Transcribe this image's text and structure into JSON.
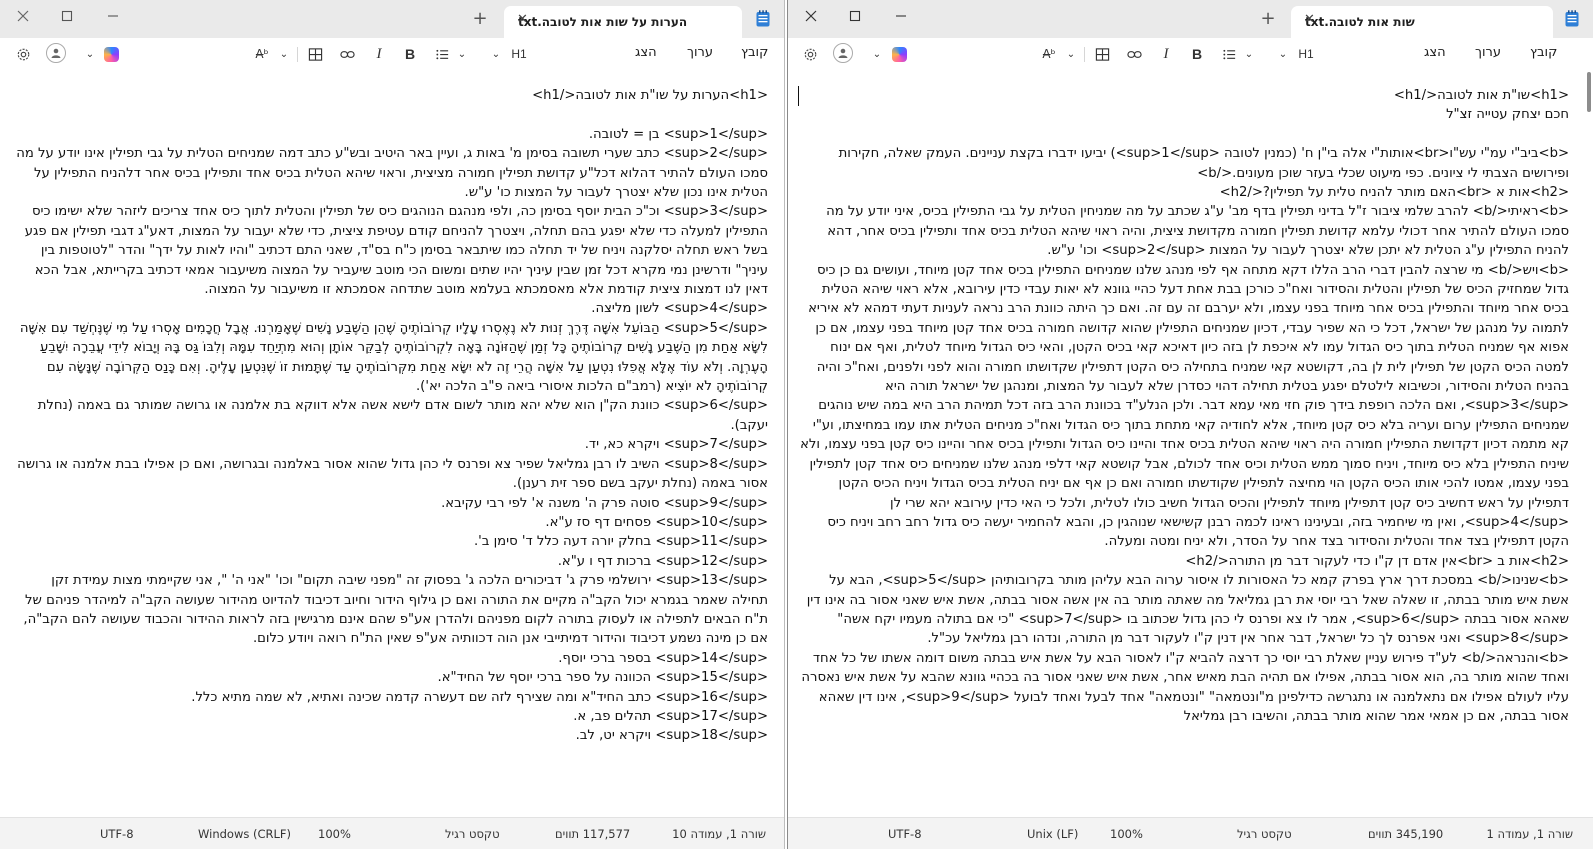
{
  "left": {
    "tab_title": "הערות על שות אות לטובה.txt",
    "menus": [
      "קובץ",
      "ערוך",
      "הצג"
    ],
    "heading_tool": "H1",
    "content": [
      "<h1>הערות על שו\"ת אות לטובה</h1>",
      "",
      "<sup>1</sup> בן = לטובה.",
      "<sup>2</sup> כתב שערי תשובה בסימן מ' באות ג, ועיין באר היטיב ובש\"ע כתב דמה שמניחים הטלית על גבי תפילין אינו יודע על מה סמכו העולם להתיר דהלוא דכל\"ע קדושת תפילין חמורה מציצית, וראוי שיהא הטלית בכיס אחד ותפילין בכיס אחר דלהניח התפילין על הטלית אינו נכון שלא יצטרך לעבור על המצות כו' ע\"ש.",
      "<sup>3</sup> וכ\"כ הבית יוסף בסימן כה, ולפי מנהגם הנוהגים כיס של תפילין והטלית לתוך כיס אחד צריכים ליזהר שלא ישימו כיס התפילין למעלה כדי שלא יפגע בהם תחלה, ויצטרך להניחם קודם עטיפת ציצית, כדי שלא יעבור על המצות, דאע\"ג דגבי תפילין אם פגע בשל ראש תחלה יסלקנה ויניח של יד תחלה כמו שיתבאר בסימן כ\"ח בס\"ד, שאני התם דכתיב \"והיו לאות על ידך\" והדר \"לטוטפות בין עיניך\" ודרשינן נמי מקרא דכל זמן שבין עיניך יהיו שתים ומשום הכי מוטב שיעביר על המצוה משיעבור אמאי דכתיב בקרייתא, אבל הכא דאין לנו דמצות ציצית קודמת אלא מאסמכתא בעלמא מוטב שתדחה אסמכתא זו משיעבור על המצוה.",
      "<sup>4</sup> לשון מליצה.",
      "<sup>5</sup> הַבּוֹעֵל אִשָּׁה דֶּרֶךְ זְנוּת לֹא נֶאֶסְרוּ עָלָיו קְרוֹבוֹתֶיהָ שֶׁהֵן הַשֶּׁבַע נָשִׁים שֶׁאָמַרְנוּ. אֲבָל חֲכָמִים אָסְרוּ עַל מִי שֶׁנֶּחְשַׁד עִם אִשָּׁה לִשָּׂא אַחַת מִן הַשֶּׁבַע נָשִׁים קְרוֹבוֹתֶיהָ כָּל זְמַן שֶׁהַזּוֹנָה בָּאָה לִקְרוֹבוֹתֶיהָ לְבַקֵּר אוֹתָן וְהוּא מִתְיַחֵד עִמָּהּ וְלִבּוֹ גַּס בָּהּ וְיָבוֹא לִידֵי עֲבֵרָה יִשָּׁבֵעַ הָעֶרְוָה. וְלֹא עוֹד אֶלָּא אֲפִלּוּ נִטְעַן עַל אִשָּׁה הֲרֵי זֶה לֹא יִשָּׂא אַחַת מִקְּרוֹבוֹתֶיהָ עַד שֶׁתָּמוּת זוֹ שֶׁנִּטְעַן עָלֶיהָ. וְאִם כָּנַס הַקְּרוֹבָה שֶׁנָּשָׂה עִם קְרוֹבוֹתֶיהָ לֹא יוֹצִיא (רמב\"ם הלכות איסורי ביאה פ\"ב הלכה יא').",
      "<sup>6</sup> כוונת הק\"ן הוא שלא יהא מותר לשום אדם לישא אשה אלא דווקא בת אלמנה או גרושה שמותר גם באמה (נחלת יעקב).",
      "<sup>7</sup> ויקרא כא, יד.",
      "<sup>8</sup> השיב לו רבן גמליאל שפיר צא ופרנס לי כהן גדול שהוא אסור באלמנה ובגרושה, ואם כן אפילו בבת אלמנה או גרושה אסור באמה (נחלת יעקב בשם ספר זית רענן).",
      "<sup>9</sup> סוטה פרק ה' משנה א' לפי רבי עקיבא.",
      "<sup>10</sup> פסחים דף סז ע\"א.",
      "<sup>11</sup> בחלק יורה דעה כלל ד' סימן ב'.",
      "<sup>12</sup> ברכות דף ו ע\"א.",
      "<sup>13</sup> ירושלמי פרק ג' דביכורים הלכה ג' בפסוק זה \"מפני שיבה תקום\" וכו' \"אני ה' \", אני שקיימתי מצות עמידת זקן תחילה שאמר בגמרא יכול הקב\"ה מקיים את התורה ואם כן גילוף הידור וחיוב דכיבוד להדיוט מהידור שעושה הקב\"ה למיהדר פניהם של ת\"ח הבאים לתפילה או לעסוק בתורה לקום מפניהם ולהדרן אע\"פ שהם אינם מרגישין בזה לראות ההידור והכבוד שעושה להם הקב\"ה, אם כן מינה נשמע דכיבוד והידור דמיתייבי אנן הוה דכוותיה אע\"פ שאין הת\"ח רואה ויודע כלום.",
      "<sup>14</sup> בספר ברכי יוסף.",
      "<sup>15</sup> הכוונה על ספר ברכי יוסף של החיד\"א.",
      "<sup>16</sup> כתב החיד\"א ומה שצירף לזה שם דעשרה קדמה שכינה ואתיא, לא שמה מתיא כלל.",
      "<sup>17</sup> תהלים פב, א.",
      "<sup>18</sup> ויקרא יט, לב."
    ],
    "status": {
      "position": "שורה 1, עמודה 10",
      "chars": "117,577 תווים",
      "format": "טקסט רגיל",
      "zoom": "100%",
      "line_ending": "Windows (CRLF)",
      "encoding": "UTF-8"
    }
  },
  "right": {
    "tab_title": "שות אות לטובה.txt",
    "menus": [
      "קובץ",
      "ערוך",
      "הצג"
    ],
    "heading_tool": "H1",
    "content": [
      "<h1>שו\"ת אות לטובה</h1>",
      "חכם יצחק עטייה זצ\"ל",
      "",
      "<b>ביב\"י עמ\"י עש\"ו<br>אותות\"י אלה בי\"ן ח' (כמנין לטובה <sup>1</sup>) יביעו ידברו בקצת עניינים. העמק שאלה, חקירות ופירושים הצבתי לי ציונים. כפי מיעוט שכלי בעזר שוכן מעונים.</b>",
      "<h2>אות א <br>האם מותר להניח טלית על תפילין?</h2>",
      "<b>ראיתי</b> להרב שלמי ציבור ז\"ל בדיני תפילין בדף מב' ע\"ג שכתב על מה שמניחין הטלית על גבי התפילין בכיס, איני יודע על מה סמכו העולם להתיר אחר דכולי עלמא קדושת תפילין חמורה מקדושת ציצית, והיה ראוי שיהא הטלית בכיס אחד ותפילין בכיס אחר, דהא להניח התפילין ע\"ג הטלית לא יתכן שלא יצטרך לעבור על המצות <sup>2</sup> וכו' ע\"ש.",
      "<b>ויש</b> מי שרצה להבין דברי הרב הללו דקא מתחה אף לפי מנהג שלנו שמניחים התפילין בכיס אחד קטן מיוחד, ועושים גם כן כיס גדול שמחזיק הכיס של תפילין והטלית והסידור ואח\"כ כורכן בבת אחת דעל כהיי גוונא לא יאות עבדי כדין עירובא, אלא ראוי שיהא הטלית בכיס אחר מיוחד והתפילין בכיס אחר מיוחד בפני עצמו, ולא יערבם זה עם זה. ואם כך היתה כוונת הרב נראה לעניות דעתי דמהא לא איריא לתמוה על מנהגן של ישראל, דכל כי הא שפיר עבדי, דכיון שמניחים התפילין שהוא קדושה חמורה בכיס אחד קטן מיוחד בפני עצמו, אם כן אפוא אף שמניח הטלית בתוך כיס הגדול עמו לא איכפת לן בזה כיון דאיכא קאי בכיס הקטן, והאי כיס הגדול מיוחד לטלית, ואף אם ינוח למטה הכיס הקטן של תפילין לית לן בה, דקושטא קאי שמניח בתחילה כיס הקטן דתפילין שקדושתו חמורה והוא לפני ולפנים, ואח\"כ והיה בהניח הטלית והסידור, וכשיבוא לילטלם יפגע בטלית תחילה דהוי כסדרן שלא לעבור על המצות, ומנהגן של ישראל תורה היא <sup>3</sup>, ואם הלכה רופפת בידך פוק חזי מאי עמא דבר. ולכן הנלע\"ד בכוונת הרב בזה דכל תמיהת הרב היא במה שיש נוהגים שמניחים התפילין ערום ועריה בלא כיס קטן מיוחד, אלא לחודיה קאי מתחת בתוך כיס הגדול ואח\"כ מניחים הטלית אתו עמו במחיצתו, וע\"י קא מתמה דכיון דקדושת התפילין חמורה היה ראוי שיהא הטלית בכיס אחד והיינו כיס הגדול ותפילין בכיס אחר והיינו כיס קטן בפני עצמו, ולא שיניח התפילין בלא כיס מיוחד, ויניח סמוך ממש הטלית וכיס אחד לכולם, אבל קושטא קאי דלפי מנהג שלנו שמניחים כיס אחד קטן לתפילין בפני עצמו, אמטו להכי אותו הכיס הקטן הוי מחיצה לתפילין שקודשתו חמורה ואם כן אף אם יניח הטלית בכיס הגדול ויניח הכיס הקטן דתפילין על ראש דחשיב כיס קטן דתפילין מיוחד לתפילין והכיס הגדול חשיב כולו לטלית, ולכל כי האי כדין עירובא יהא שרי לן <sup>4</sup>, ואין מי שיחמיר בזה, ובעינינו ראינו לכמה רבנן קשישאי שנוהגין כן, והבא להחמיר יעשה כיס גדול רחב רחב ויניח כיס הקטן דתפילין בצד אחד והטלית והסידור בצד אחר על הסדר, ולא יניח ומטה ומעלה.",
      "<h2>אות ב <br>אין אדם דן ק\"ו כדי לעקור דבר מן התורה</h2>",
      "<b>שנינו</b> במסכת דרך ארץ בפרק קמא כל האסורות לו איסור ערוה הבא עליהן מותר בקרובותיהן <sup>5</sup>, הבא על אשת איש מותר בבתה, זו שאלה שאל רבי יוסי את רבן גמליאל מה שאתה מותר בה אין אשה אסור בבתה, אשת איש שאני אסור בה אינו דין שאהא אסור בבתה <sup>6</sup>, אמר לו צא ופרנס לי כהן גדול שכתוב בו <sup>7</sup> \"כי אם בתולה מעמיו יקח אשה\" <sup>8</sup> ואני אפרנס לך כל ישראל, דבר אחר אין דנין ק\"ו לעקור דבר מן התורה, ונדהו רבן גמליאל עכ\"ל.",
      "<b>והנראה</b> לע\"ד פירוש עניין שאלת רבי יוסי כך דרצה להביא ק\"ו לאסור הבא על אשת איש בבתה משום דומה אשתו של כל אחד ואחד שהוא מותר בה, הוא אסור בבתה, אפילו אם תהיה הבת מאיש אחר, אשת איש שאני אסור בה בכהיי גוונא שהבא על אשת איש נאסרה עליו לעולם אפילו אם נתאלמנה או נתגרשה כדילפינן מ\"ונטמאה\" \"ונטמאה\" אחד לבעל ואחד לבועל <sup>9</sup>, אינו דין שאהא אסור בבתה, אם כן אמאי אמר שהוא מותר בבתה, והשיבו רבן גמליאל"
    ],
    "status": {
      "position": "שורה 1, עמודה 1",
      "chars": "345,190 תווים",
      "format": "טקסט רגיל",
      "zoom": "100%",
      "line_ending": "Unix (LF)",
      "encoding": "UTF-8"
    }
  },
  "icons": {
    "minimize": "minimize-icon",
    "maximize": "maximize-icon",
    "close": "close-icon",
    "settings": "gear-icon",
    "account": "person-icon",
    "copilot": "copilot-icon",
    "rewrite": "rewrite-icon",
    "table": "table-icon",
    "link": "link-icon",
    "list": "list-icon",
    "notepad": "notepad-icon"
  },
  "colors": {
    "titlebar": "#eaeaea",
    "statusbar": "#f3f3f3",
    "text": "#111111"
  }
}
